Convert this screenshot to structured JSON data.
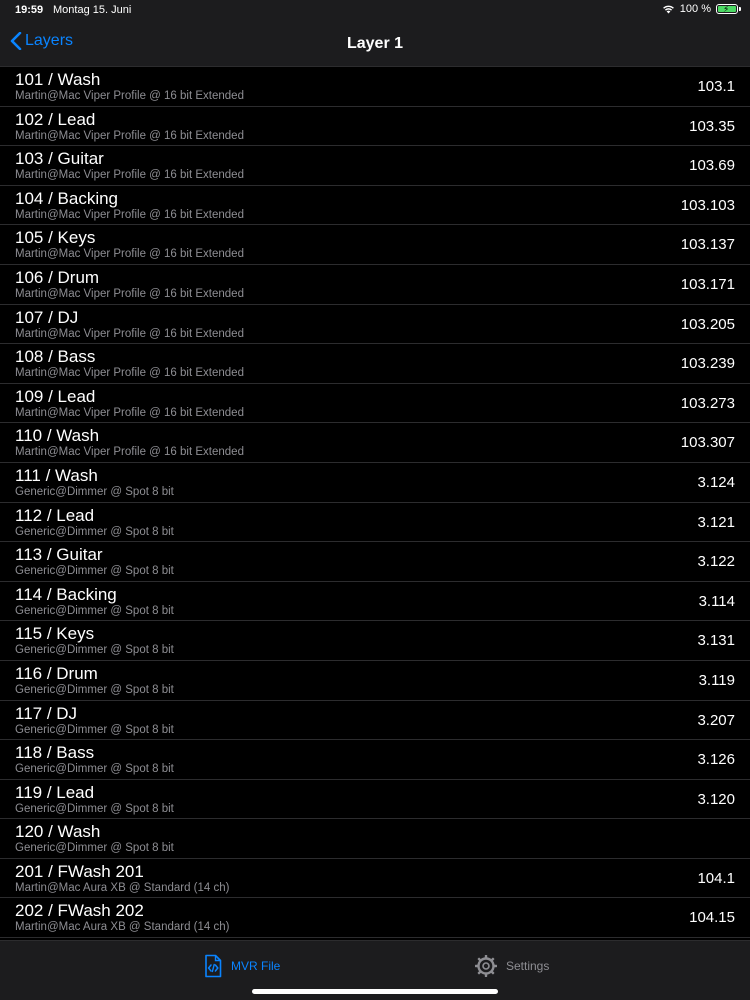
{
  "status": {
    "time": "19:59",
    "date": "Montag 15. Juni",
    "battery": "100 %"
  },
  "nav": {
    "back_label": "Layers",
    "title": "Layer 1"
  },
  "rows": [
    {
      "title": "101 / Wash",
      "subtitle": "Martin@Mac Viper Profile @ 16 bit Extended",
      "value": "103.1"
    },
    {
      "title": "102 / Lead",
      "subtitle": "Martin@Mac Viper Profile @ 16 bit Extended",
      "value": "103.35"
    },
    {
      "title": "103 / Guitar",
      "subtitle": "Martin@Mac Viper Profile @ 16 bit Extended",
      "value": "103.69"
    },
    {
      "title": "104 / Backing",
      "subtitle": "Martin@Mac Viper Profile @ 16 bit Extended",
      "value": "103.103"
    },
    {
      "title": "105 / Keys",
      "subtitle": "Martin@Mac Viper Profile @ 16 bit Extended",
      "value": "103.137"
    },
    {
      "title": "106 / Drum",
      "subtitle": "Martin@Mac Viper Profile @ 16 bit Extended",
      "value": "103.171"
    },
    {
      "title": "107 / DJ",
      "subtitle": "Martin@Mac Viper Profile @ 16 bit Extended",
      "value": "103.205"
    },
    {
      "title": "108 / Bass",
      "subtitle": "Martin@Mac Viper Profile @ 16 bit Extended",
      "value": "103.239"
    },
    {
      "title": "109 / Lead",
      "subtitle": "Martin@Mac Viper Profile @ 16 bit Extended",
      "value": "103.273"
    },
    {
      "title": "110 / Wash",
      "subtitle": "Martin@Mac Viper Profile @ 16 bit Extended",
      "value": "103.307"
    },
    {
      "title": "111 / Wash",
      "subtitle": "Generic@Dimmer @ Spot 8 bit",
      "value": "3.124"
    },
    {
      "title": "112 / Lead",
      "subtitle": "Generic@Dimmer @ Spot 8 bit",
      "value": "3.121"
    },
    {
      "title": "113 / Guitar",
      "subtitle": "Generic@Dimmer @ Spot 8 bit",
      "value": "3.122"
    },
    {
      "title": "114 / Backing",
      "subtitle": "Generic@Dimmer @ Spot 8 bit",
      "value": "3.114"
    },
    {
      "title": "115 / Keys",
      "subtitle": "Generic@Dimmer @ Spot 8 bit",
      "value": "3.131"
    },
    {
      "title": "116 / Drum",
      "subtitle": "Generic@Dimmer @ Spot 8 bit",
      "value": "3.119"
    },
    {
      "title": "117 / DJ",
      "subtitle": "Generic@Dimmer @ Spot 8 bit",
      "value": "3.207"
    },
    {
      "title": "118 / Bass",
      "subtitle": "Generic@Dimmer @ Spot 8 bit",
      "value": "3.126"
    },
    {
      "title": "119 / Lead",
      "subtitle": "Generic@Dimmer @ Spot 8 bit",
      "value": "3.120"
    },
    {
      "title": "120 / Wash",
      "subtitle": "Generic@Dimmer @ Spot 8 bit",
      "value": ""
    },
    {
      "title": "201 / FWash 201",
      "subtitle": "Martin@Mac Aura XB @ Standard (14 ch)",
      "value": "104.1"
    },
    {
      "title": "202 / FWash 202",
      "subtitle": "Martin@Mac Aura XB @ Standard (14 ch)",
      "value": "104.15"
    }
  ],
  "tabs": [
    {
      "label": "MVR File",
      "icon": "code-file-icon",
      "active": true
    },
    {
      "label": "Settings",
      "icon": "gear-icon",
      "active": false
    }
  ],
  "colors": {
    "accent": "#0a84ff",
    "background": "#000000",
    "bar": "#1c1c1e",
    "secondary_text": "#8e8e93"
  }
}
